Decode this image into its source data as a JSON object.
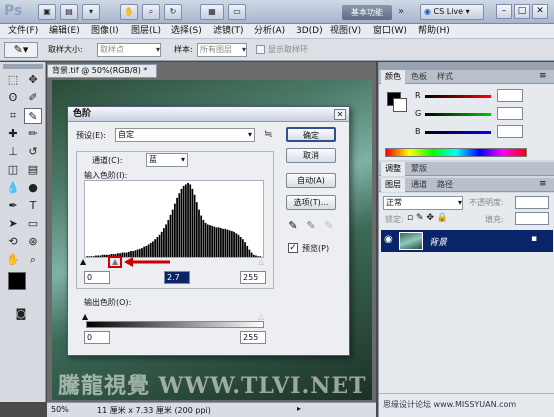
{
  "app": {
    "logo": "Ps",
    "essentials": "基本功能",
    "cs_live": "CS Live"
  },
  "menu": [
    "文件(F)",
    "编辑(E)",
    "图像(I)",
    "图层(L)",
    "选择(S)",
    "滤镜(T)",
    "分析(A)",
    "3D(D)",
    "视图(V)",
    "窗口(W)",
    "帮助(H)"
  ],
  "options": {
    "sample_size_label": "取样大小:",
    "sample_size_value": "取样点",
    "sample_label": "样本:",
    "sample_value": "所有图层",
    "show_ring_label": "显示取样环"
  },
  "document": {
    "tab_title": "背景.tif @ 50%(RGB/8) *",
    "watermark": "騰龍視覺 WWW.TLVI.NET",
    "zoom": "50%",
    "doc_info": "11 厘米 x 7.33 厘米 (200 ppi)"
  },
  "panels": {
    "top_tabs": [
      "颜色",
      "色板",
      "样式"
    ],
    "color_channels": [
      "R",
      "G",
      "B"
    ],
    "adjust_tabs": [
      "调整",
      "蒙版"
    ],
    "layer_tabs": [
      "图层",
      "通道",
      "路径"
    ],
    "blend_mode": "正常",
    "opacity_label": "不透明度:",
    "lock_label": "锁定:",
    "fill_label": "填充:",
    "layer_name": "背景",
    "footer_watermark": "思缘设计论坛  www.MISSYUAN.com"
  },
  "dialog": {
    "title": "色阶",
    "preset_label": "预设(E):",
    "preset_value": "自定",
    "channel_label": "通道(C):",
    "channel_value": "蓝",
    "input_label": "输入色阶(I):",
    "input_black": "0",
    "input_mid": "2.7",
    "input_white": "255",
    "output_label": "输出色阶(O):",
    "output_black": "0",
    "output_white": "255",
    "ok": "确定",
    "cancel": "取消",
    "auto": "自动(A)",
    "options": "选项(T)...",
    "preview": "预览(P)",
    "preview_checked": true,
    "histogram": [
      1,
      1,
      1,
      1,
      2,
      2,
      2,
      3,
      3,
      3,
      3,
      4,
      4,
      4,
      5,
      5,
      6,
      6,
      6,
      7,
      8,
      8,
      9,
      10,
      11,
      12,
      14,
      15,
      17,
      19,
      21,
      24,
      27,
      30,
      34,
      39,
      44,
      50,
      57,
      64,
      72,
      80,
      86,
      92,
      96,
      98,
      100,
      98,
      92,
      84,
      74,
      64,
      56,
      50,
      46,
      44,
      43,
      42,
      41,
      40,
      40,
      39,
      38,
      38,
      37,
      36,
      35,
      34,
      32,
      30,
      27,
      24,
      20,
      15,
      10,
      6,
      3,
      2,
      1,
      1
    ]
  },
  "colors": {
    "accent": "#0a246a",
    "highlight": "#cc0000"
  }
}
